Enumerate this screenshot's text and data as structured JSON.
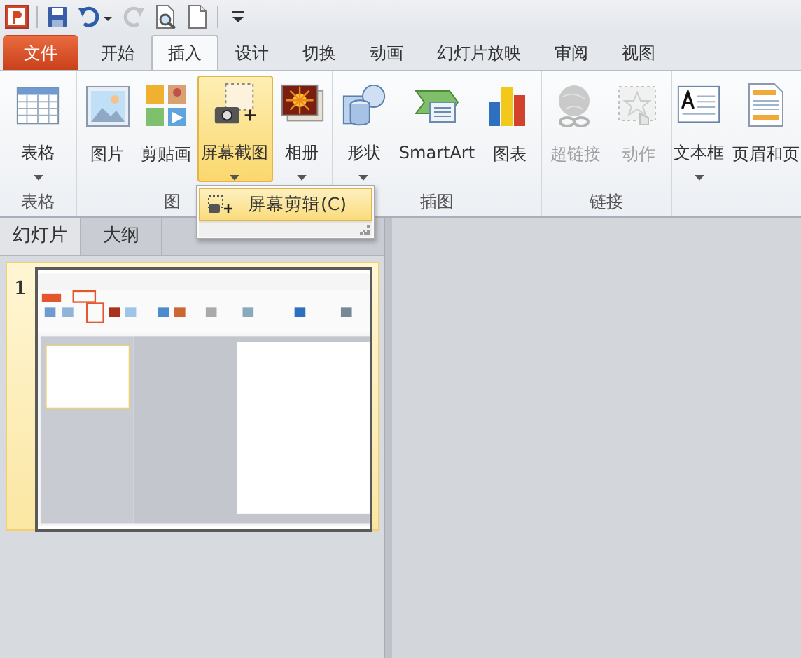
{
  "quick_access": [
    {
      "disabled": false
    },
    {
      "disabled": false
    },
    {
      "disabled": false
    },
    {
      "disabled": true
    },
    {
      "disabled": false
    },
    {
      "disabled": false
    },
    {
      "disabled": false
    }
  ],
  "tabs": [
    {
      "label": "文件",
      "kind": "file",
      "selected": false
    },
    {
      "label": "开始",
      "kind": "normal",
      "selected": false
    },
    {
      "label": "插入",
      "kind": "normal",
      "selected": true
    },
    {
      "label": "设计",
      "kind": "normal",
      "selected": false
    },
    {
      "label": "切换",
      "kind": "normal",
      "selected": false
    },
    {
      "label": "动画",
      "kind": "normal",
      "selected": false
    },
    {
      "label": "幻灯片放映",
      "kind": "normal",
      "selected": false
    },
    {
      "label": "审阅",
      "kind": "normal",
      "selected": false
    },
    {
      "label": "视图",
      "kind": "normal",
      "selected": false
    }
  ],
  "ribbon": {
    "groups": [
      {
        "label": "表格",
        "buttons": [
          {
            "label": "表格",
            "dropdown": true,
            "highlighted": false,
            "disabled": false
          }
        ]
      },
      {
        "label": "图",
        "buttons": [
          {
            "label": "图片",
            "dropdown": false,
            "highlighted": false,
            "disabled": false
          },
          {
            "label": "剪贴画",
            "dropdown": false,
            "highlighted": false,
            "disabled": false
          },
          {
            "label": "屏幕截图",
            "dropdown": true,
            "highlighted": true,
            "disabled": false
          },
          {
            "label": "相册",
            "dropdown": true,
            "highlighted": false,
            "disabled": false
          }
        ]
      },
      {
        "label": "插图",
        "buttons": [
          {
            "label": "形状",
            "dropdown": true,
            "highlighted": false,
            "disabled": false
          },
          {
            "label": "SmartArt",
            "dropdown": false,
            "highlighted": false,
            "disabled": false
          },
          {
            "label": "图表",
            "dropdown": false,
            "highlighted": false,
            "disabled": false
          }
        ]
      },
      {
        "label": "链接",
        "buttons": [
          {
            "label": "超链接",
            "dropdown": false,
            "highlighted": false,
            "disabled": true
          },
          {
            "label": "动作",
            "dropdown": false,
            "highlighted": false,
            "disabled": true
          }
        ]
      },
      {
        "buttons": [
          {
            "label": "文本框",
            "dropdown": true,
            "highlighted": false,
            "disabled": false
          },
          {
            "label": "页眉和页",
            "dropdown": false,
            "highlighted": false,
            "disabled": false
          }
        ]
      }
    ]
  },
  "dropdown_menu": {
    "items": [
      {
        "label": "屏幕剪辑(C)",
        "highlighted": true
      }
    ]
  },
  "panel": {
    "tabs": [
      {
        "label": "幻灯片",
        "selected": true
      },
      {
        "label": "大纲",
        "selected": false
      }
    ],
    "slides": [
      {
        "number": "1",
        "selected": true
      }
    ]
  }
}
